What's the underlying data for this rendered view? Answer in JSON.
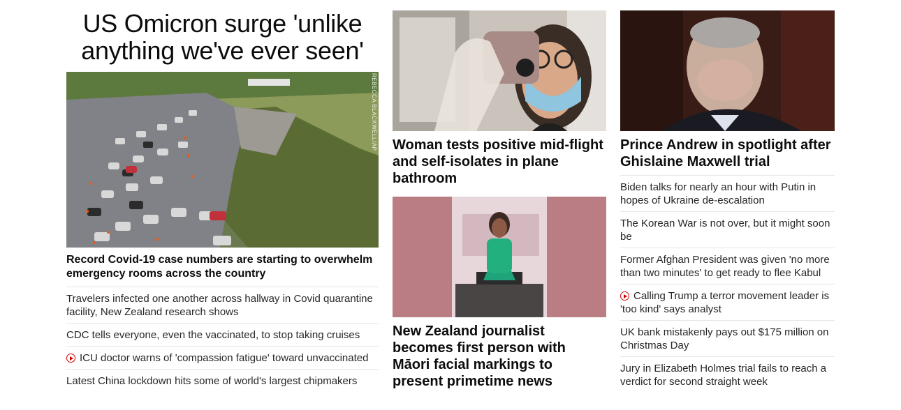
{
  "banner": {
    "headline": "US Omicron surge 'unlike anything we've ever seen'"
  },
  "column1": {
    "lead": {
      "photo_credit": "REBECCA BLACKWELL/AP",
      "headline": "Record Covid-19 case numbers are starting to overwhelm emergency rooms across the country"
    },
    "items": [
      {
        "text": "Travelers infected one another across hallway in Covid quarantine facility, New Zealand research shows",
        "video": false
      },
      {
        "text": "CDC tells everyone, even the vaccinated, to stop taking cruises",
        "video": false
      },
      {
        "text": "ICU doctor warns of 'compassion fatigue' toward unvaccinated",
        "video": true
      },
      {
        "text": "Latest China lockdown hits some of world's largest chipmakers",
        "video": false
      }
    ]
  },
  "column2": {
    "card1": {
      "headline": "Woman tests positive mid-flight and self-isolates in plane bathroom"
    },
    "card2": {
      "headline": "New Zealand journalist becomes first person with Māori facial markings to present primetime news"
    }
  },
  "column3": {
    "card1": {
      "headline": "Prince Andrew in spotlight after Ghislaine Maxwell trial"
    },
    "items": [
      {
        "text": "Biden talks for nearly an hour with Putin in hopes of Ukraine de-escalation",
        "video": false
      },
      {
        "text": "The Korean War is not over, but it might soon be",
        "video": false
      },
      {
        "text": "Former Afghan President was given 'no more than two minutes' to get ready to flee Kabul",
        "video": false
      },
      {
        "text": "Calling Trump a terror movement leader is 'too kind' says analyst",
        "video": true
      },
      {
        "text": "UK bank mistakenly pays out $175 million on Christmas Day",
        "video": false
      },
      {
        "text": "Jury in Elizabeth Holmes trial fails to reach a verdict for second straight week",
        "video": false
      }
    ]
  },
  "colors": {
    "video_icon": "#cc0000",
    "divider": "#e6e6e6",
    "headline": "#0c0c0c"
  },
  "icons": {
    "video": "play-circle-icon"
  }
}
